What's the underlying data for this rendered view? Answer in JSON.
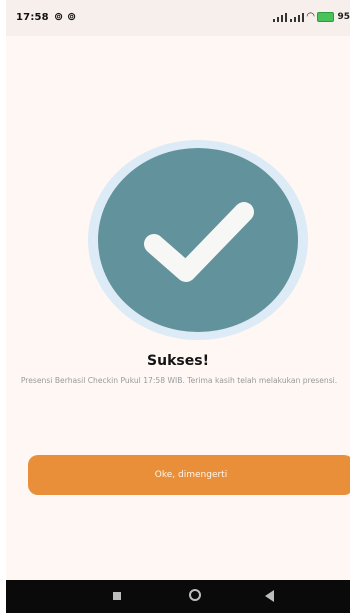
{
  "status_bar": {
    "time": "17:58",
    "left_icons": "⊚ ⊚",
    "battery": "95"
  },
  "dialog": {
    "title": "Sukses!",
    "message": "Presensi Berhasil Checkin Pukul 17:58 WIB. Terima kasih telah melakukan presensi.",
    "button_label": "Oke, dimengerti"
  },
  "colors": {
    "background": "#fff7f4",
    "circle": "#62929c",
    "halo": "#dcebf6",
    "button": "#e98f39"
  },
  "icons": {
    "success": "checkmark-icon",
    "nav": [
      "recents-icon",
      "home-icon",
      "back-icon"
    ]
  }
}
